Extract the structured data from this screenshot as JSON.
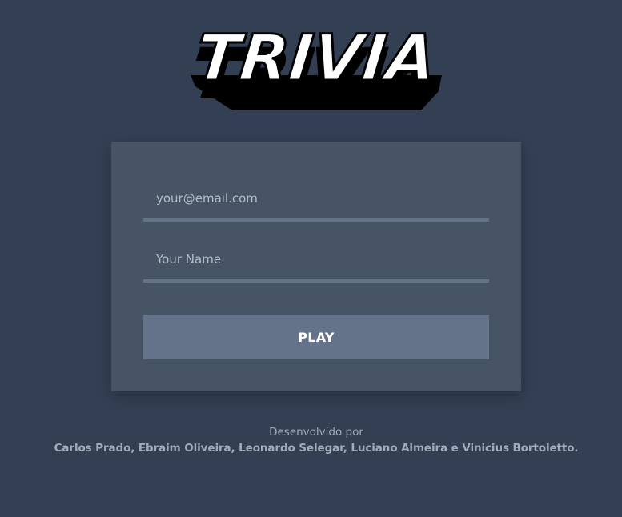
{
  "logo": {
    "text": "TRIVIA"
  },
  "form": {
    "email_placeholder": "your@email.com",
    "name_placeholder": "Your Name",
    "play_label": "PLAY"
  },
  "footer": {
    "developed_by": "Desenvolvido por",
    "authors": "Carlos Prado, Ebraim Oliveira, Leonardo Selegar, Luciano Almeira e Vinicius Bortoletto."
  },
  "colors": {
    "background": "#333f53",
    "card": "#465466",
    "accent": "#65738a",
    "text_muted": "#a2abb9"
  }
}
